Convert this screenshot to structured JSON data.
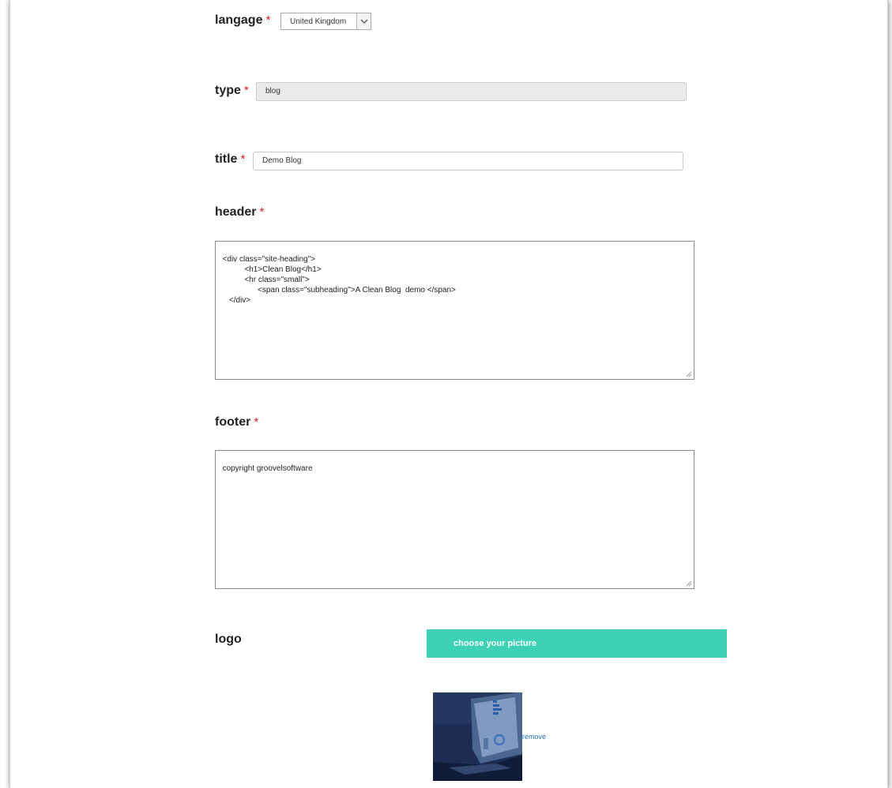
{
  "form": {
    "language": {
      "label": "langage",
      "required_mark": "*",
      "value": "United Kingdom"
    },
    "type": {
      "label": "type",
      "required_mark": "*",
      "value": "blog"
    },
    "title": {
      "label": "title",
      "required_mark": "*",
      "value": "Demo Blog"
    },
    "header": {
      "label": "header",
      "required_mark": "*",
      "value": "<div class=\"site-heading\">\n            <h1>Clean Blog</h1>\n            <hr class=\"small\">\n                  <span class=\"subheading\">A Clean Blog  demo </span>\n     </div>"
    },
    "footer": {
      "label": "footer",
      "required_mark": "*",
      "value": "copyright groovelsoftware"
    },
    "logo": {
      "label": "logo",
      "choose_button_label": "choose your picture",
      "remove_label": "remove"
    }
  },
  "colors": {
    "required": "#e02020",
    "choose_button": "#3cd1b5",
    "link": "#2a6fb5",
    "thumbnail": "#1e2f55"
  },
  "icons": [
    "chevron-down-icon",
    "resize-grip-icon"
  ]
}
